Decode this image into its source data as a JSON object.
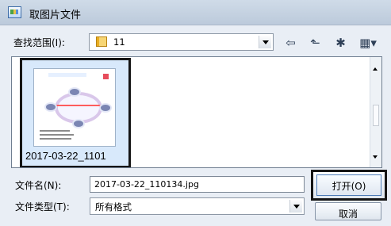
{
  "window": {
    "title": "取图片文件"
  },
  "lookin": {
    "label": "查找范围(I):",
    "folder": "11"
  },
  "toolbar": {
    "icons": [
      "back-arrow-icon",
      "up-folder-icon",
      "new-folder-icon",
      "view-menu-icon"
    ]
  },
  "files": {
    "selected_label": "2017-03-22_1101"
  },
  "filename": {
    "label": "文件名(N):",
    "value": "2017-03-22_110134.jpg"
  },
  "filetype": {
    "label": "文件类型(T):",
    "value": "所有格式"
  },
  "buttons": {
    "open": "打开(O)",
    "cancel": "取消"
  },
  "colors": {
    "window": "#e9eef5",
    "titlebar": "#c6d3e2",
    "selection": "#d8e9fb",
    "highlight": "#151515"
  }
}
